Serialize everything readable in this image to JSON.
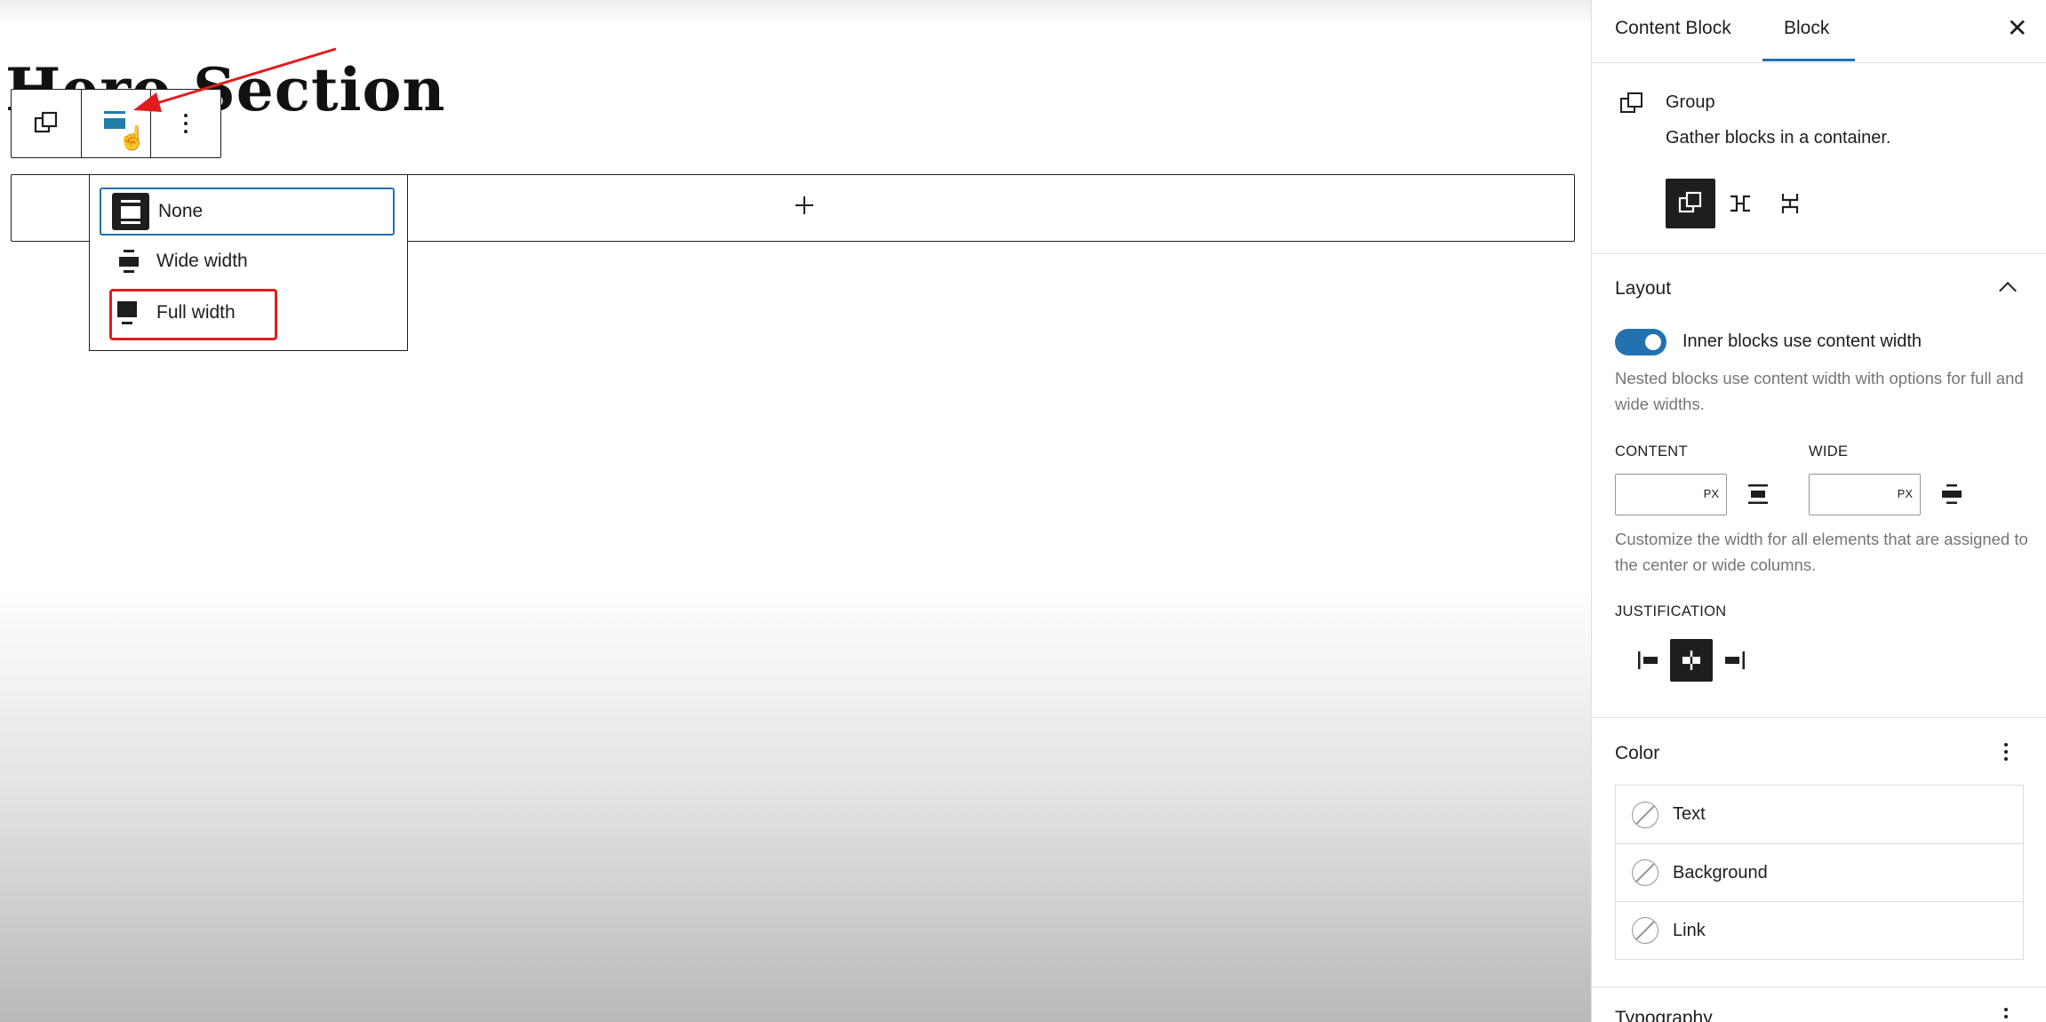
{
  "canvas": {
    "heading": "Hero Section",
    "add_block_symbol": "+",
    "toolbar": {
      "block_type_icon": "group-icon",
      "align_icon": "align-none-icon",
      "options_icon": "more-vertical-icon",
      "cursor_symbol": "☝"
    },
    "align_menu": {
      "items": [
        {
          "label": "None",
          "icon": "align-none-icon",
          "selected": true
        },
        {
          "label": "Wide width",
          "icon": "align-wide-icon",
          "selected": false
        },
        {
          "label": "Full width",
          "icon": "align-full-width-icon",
          "selected": false,
          "highlighted": true
        }
      ]
    },
    "annotation_color": "#e21c1c"
  },
  "sidebar": {
    "tabs": [
      {
        "label": "Content Block",
        "active": false
      },
      {
        "label": "Block",
        "active": true
      }
    ],
    "close_symbol": "✕",
    "block_card": {
      "title": "Group",
      "description": "Gather blocks in a container.",
      "variations": [
        "group-icon",
        "row-icon",
        "stack-icon"
      ]
    },
    "layout": {
      "title": "Layout",
      "toggle_label": "Inner blocks use content width",
      "toggle_on": true,
      "toggle_help": "Nested blocks use content width with options for full and wide widths.",
      "content_label": "CONTENT",
      "wide_label": "WIDE",
      "content_unit": "PX",
      "wide_unit": "PX",
      "content_value": "",
      "wide_value": "",
      "width_help": "Customize the width for all elements that are assigned to the center or wide columns.",
      "justification_label": "JUSTIFICATION",
      "justification_options": [
        "justify-left-icon",
        "justify-center-icon",
        "justify-right-icon"
      ],
      "justification_selected": "justify-center-icon"
    },
    "color": {
      "title": "Color",
      "items": [
        {
          "label": "Text"
        },
        {
          "label": "Background"
        },
        {
          "label": "Link"
        }
      ]
    },
    "typography": {
      "title": "Typography"
    }
  },
  "colors": {
    "accent": "#2271b1",
    "dark": "#1e1e1e",
    "help_text": "#757575"
  }
}
